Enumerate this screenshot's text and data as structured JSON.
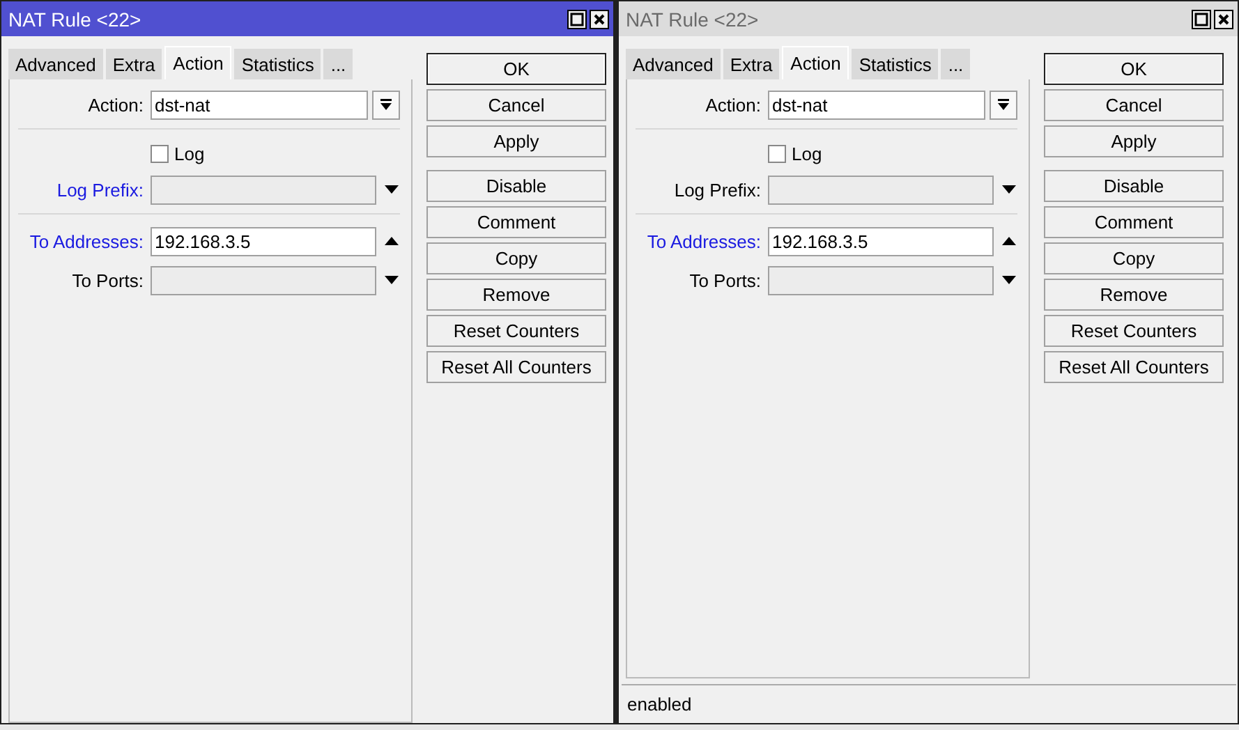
{
  "windows": [
    {
      "title": "NAT Rule <22>",
      "active": true,
      "tabs": [
        {
          "label": "Advanced",
          "selected": false
        },
        {
          "label": "Extra",
          "selected": false
        },
        {
          "label": "Action",
          "selected": true
        },
        {
          "label": "Statistics",
          "selected": false
        },
        {
          "label": "...",
          "selected": false
        }
      ],
      "fields": [
        {
          "kind": "select",
          "label": "Action:",
          "value": "dst-nat",
          "highlighted": false
        },
        {
          "kind": "separator"
        },
        {
          "kind": "checkbox",
          "label": "Log",
          "checked": false
        },
        {
          "kind": "combo",
          "label": "Log Prefix:",
          "removable": false,
          "highlighted": true
        },
        {
          "kind": "separator"
        },
        {
          "kind": "combo",
          "label": "To Addresses:",
          "value": "192.168.3.5",
          "removable": true,
          "highlighted": true
        },
        {
          "kind": "combo",
          "label": "To Ports:",
          "removable": false,
          "highlighted": false
        }
      ],
      "button_groups": [
        [
          {
            "label": "OK",
            "default": true
          },
          {
            "label": "Cancel",
            "default": false
          },
          {
            "label": "Apply",
            "default": false
          }
        ],
        [
          {
            "label": "Disable",
            "default": false
          },
          {
            "label": "Comment",
            "default": false
          },
          {
            "label": "Copy",
            "default": false
          },
          {
            "label": "Remove",
            "default": false
          },
          {
            "label": "Reset Counters",
            "default": false
          },
          {
            "label": "Reset All Counters",
            "default": false
          }
        ]
      ]
    },
    {
      "title": "NAT Rule <22>",
      "active": false,
      "tabs": [
        {
          "label": "Advanced",
          "selected": false
        },
        {
          "label": "Extra",
          "selected": false
        },
        {
          "label": "Action",
          "selected": true
        },
        {
          "label": "Statistics",
          "selected": false
        },
        {
          "label": "...",
          "selected": false
        }
      ],
      "fields": [
        {
          "kind": "select",
          "label": "Action:",
          "value": "dst-nat",
          "highlighted": false
        },
        {
          "kind": "separator"
        },
        {
          "kind": "checkbox",
          "label": "Log",
          "checked": false
        },
        {
          "kind": "combo",
          "label": "Log Prefix:",
          "removable": false,
          "highlighted": false
        },
        {
          "kind": "separator"
        },
        {
          "kind": "combo",
          "label": "To Addresses:",
          "value": "192.168.3.5",
          "removable": true,
          "highlighted": true
        },
        {
          "kind": "combo",
          "label": "To Ports:",
          "removable": false,
          "highlighted": false
        }
      ],
      "button_groups": [
        [
          {
            "label": "OK",
            "default": true
          },
          {
            "label": "Cancel",
            "default": false
          },
          {
            "label": "Apply",
            "default": false
          }
        ],
        [
          {
            "label": "Disable",
            "default": false
          },
          {
            "label": "Comment",
            "default": false
          },
          {
            "label": "Copy",
            "default": false
          },
          {
            "label": "Remove",
            "default": false
          },
          {
            "label": "Reset Counters",
            "default": false
          },
          {
            "label": "Reset All Counters",
            "default": false
          }
        ]
      ],
      "status": "enabled"
    }
  ]
}
